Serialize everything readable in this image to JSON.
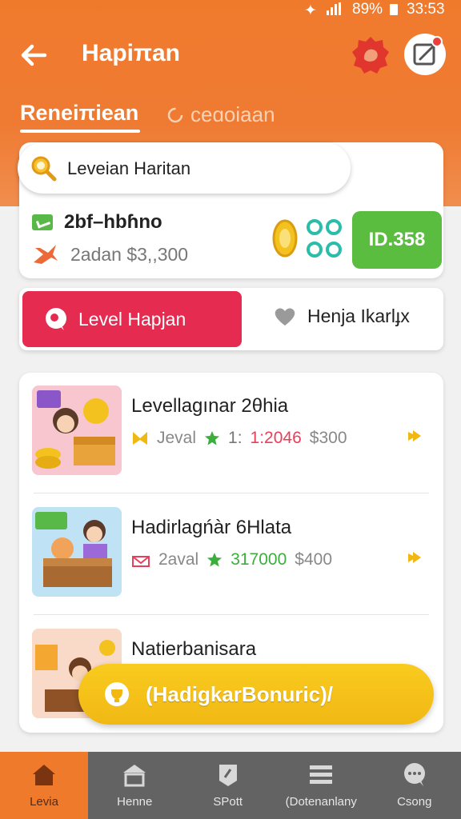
{
  "status_bar": {
    "battery": "89%",
    "time": "33:53"
  },
  "app_bar": {
    "title": "Hapiπan"
  },
  "tabs": {
    "active": "Reneiπiean",
    "inactive": "ceɑoiaan"
  },
  "search": {
    "value": "Leveian Haritan"
  },
  "summary": {
    "line1": "2bf–hbɦno",
    "line2": "2adan $3,,300",
    "button": "ID.358"
  },
  "segmented": {
    "left_label": "Level Hapjan",
    "right_label": "Henja Ikarlɟx"
  },
  "items": [
    {
      "title": "Levellagınar 2θhia",
      "meta_label": "Jeval",
      "meta_value": "1:2046",
      "price": "$300",
      "value_color": "#e8405a"
    },
    {
      "title": "Hadirlagńàr 6Hlata",
      "meta_label": "2aval",
      "meta_value": "317000",
      "price": "$400",
      "value_color": "#3cae3c"
    },
    {
      "title": "Natierbanisara"
    }
  ],
  "bonus_button": {
    "label": "(HadigkarBonuric)/"
  },
  "bottom_nav": [
    {
      "label": "Levia",
      "icon": "home-icon",
      "active": true
    },
    {
      "label": "Henne",
      "icon": "shop-icon"
    },
    {
      "label": "SPott",
      "icon": "sport-icon"
    },
    {
      "label": "(Dotenanlany",
      "icon": "list-icon"
    },
    {
      "label": "Csong",
      "icon": "chat-icon"
    }
  ],
  "colors": {
    "header_orange": "#f07a2c",
    "segment_red": "#e52c50",
    "action_green": "#5bbd3f",
    "bonus_yellow": "#f5c11a",
    "nav_gray": "#636363"
  }
}
